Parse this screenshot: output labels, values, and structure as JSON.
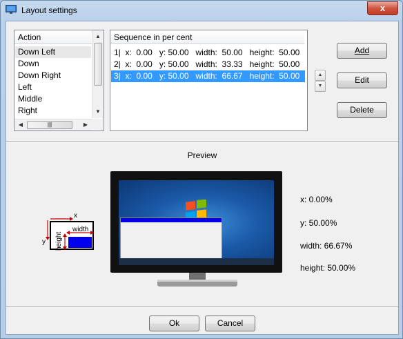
{
  "window": {
    "title": "Layout settings",
    "close_glyph": "x"
  },
  "action_list": {
    "header": "Action",
    "items": [
      "Down Left",
      "Down",
      "Down Right",
      "Left",
      "Middle",
      "Right"
    ],
    "selected_index": 0
  },
  "sequence_list": {
    "header": "Sequence in per cent",
    "rows": [
      "1|  x:  0.00   y: 50.00   width:  50.00   height:  50.00",
      "2|  x:  0.00   y: 50.00   width:  33.33   height:  50.00",
      "3|  x:  0.00   y: 50.00   width:  66.67   height:  50.00"
    ],
    "selected_index": 2
  },
  "buttons": {
    "add": "Add",
    "edit": "Edit",
    "delete": "Delete",
    "ok": "Ok",
    "cancel": "Cancel"
  },
  "preview": {
    "label": "Preview",
    "legend": {
      "x": "x",
      "y": "y",
      "width": "width",
      "height": "height"
    },
    "x": "x: 0.00%",
    "y": "y: 50.00%",
    "width": "width: 66.67%",
    "height": "height: 50.00%"
  },
  "colors": {
    "selection": "#3399ff",
    "window_bar": "#0000e0",
    "legend_arrow": "#cc0000"
  },
  "icons": {
    "title": "monitor-icon",
    "up": "up-arrow-icon",
    "down": "down-arrow-icon"
  }
}
